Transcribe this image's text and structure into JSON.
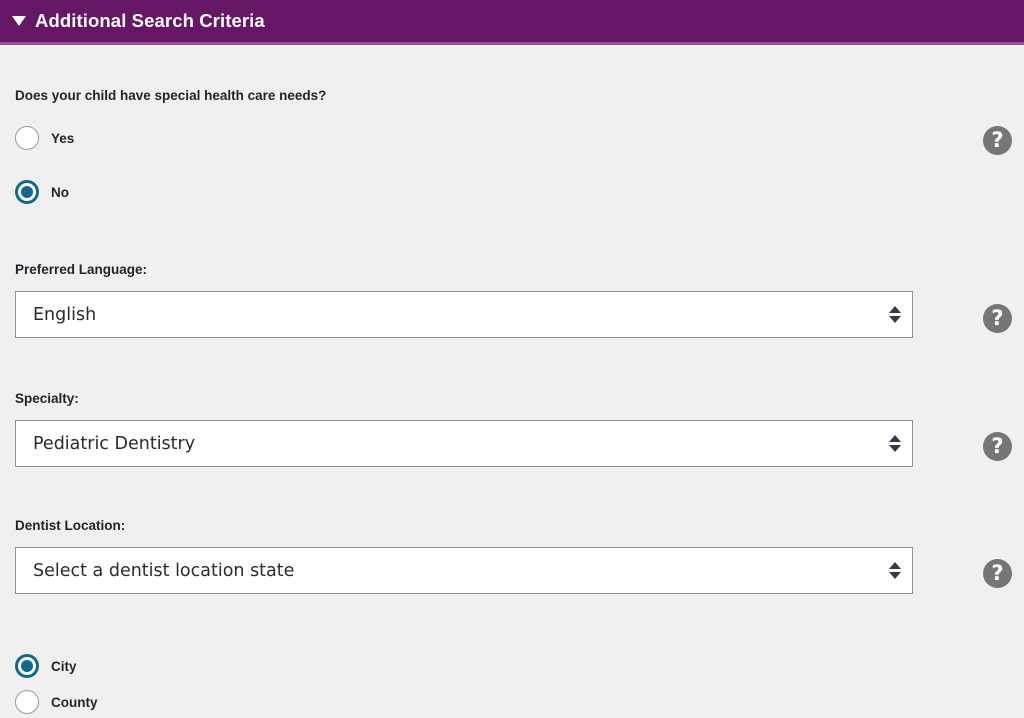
{
  "header": {
    "title": "Additional Search Criteria",
    "expanded_icon": "triangle-down-icon",
    "background_color": "#651765",
    "divider_color": "#9a4f9a",
    "text_color": "#ffffff"
  },
  "colors": {
    "page_background": "#f0f0f0",
    "accent_radio": "#11688f",
    "label_text": "#1d242c",
    "help_icon_background": "#767676",
    "select_border": "#8d9199"
  },
  "help_icon": {
    "glyph": "?",
    "name": "help-icon"
  },
  "fields": {
    "special_needs": {
      "label": "Does your child have special health care needs?",
      "options": [
        {
          "label": "Yes",
          "selected": false
        },
        {
          "label": "No",
          "selected": true
        }
      ],
      "has_help": true
    },
    "preferred_language": {
      "label": "Preferred Language:",
      "value": "English",
      "is_placeholder": false,
      "has_help": true
    },
    "specialty": {
      "label": "Specialty:",
      "value": "Pediatric Dentistry",
      "is_placeholder": false,
      "has_help": true
    },
    "dentist_location": {
      "label": "Dentist Location:",
      "value": "Select a dentist location state",
      "is_placeholder": true,
      "has_help": true
    },
    "location_type": {
      "options": [
        {
          "label": "City",
          "selected": true
        },
        {
          "label": "County",
          "selected": false
        }
      ],
      "has_help": false
    }
  }
}
